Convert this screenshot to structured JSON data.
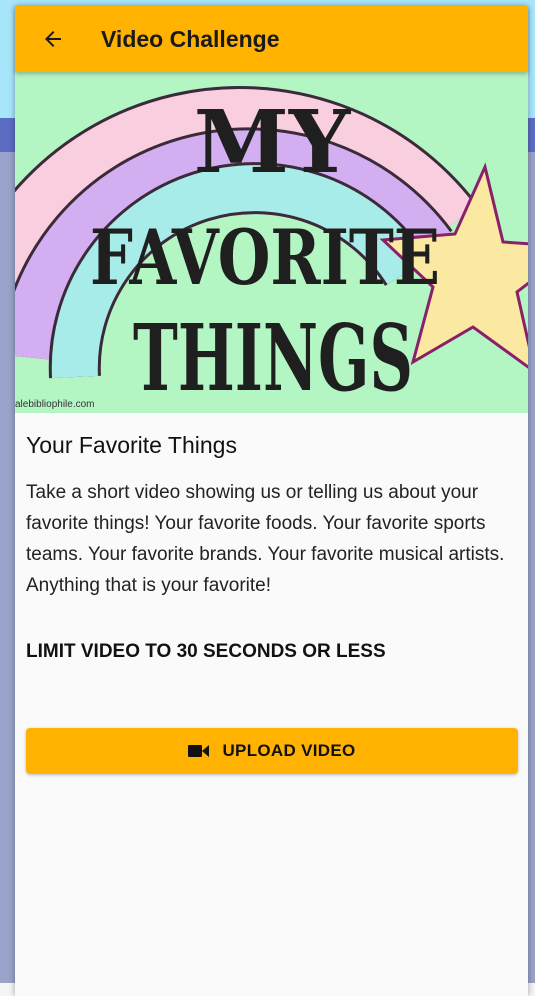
{
  "app": {
    "title": "Video Challenge",
    "accent_color": "#ffb300"
  },
  "toolbar": {
    "back_icon": "arrow-left-icon"
  },
  "banner": {
    "lines": [
      "MY",
      "FAVORITE",
      "THINGS"
    ],
    "credit": "alebibliophile.com"
  },
  "challenge": {
    "heading": "Your Favorite Things",
    "description": "Take a short video showing us or telling us about your favorite things! Your favorite foods. Your favorite sports teams. Your favorite brands. Your favorite musical artists. Anything that is your favorite!",
    "limit": "LIMIT VIDEO TO 30 SECONDS OR LESS"
  },
  "actions": {
    "upload_label": "UPLOAD VIDEO",
    "upload_icon": "video-camera-icon"
  }
}
